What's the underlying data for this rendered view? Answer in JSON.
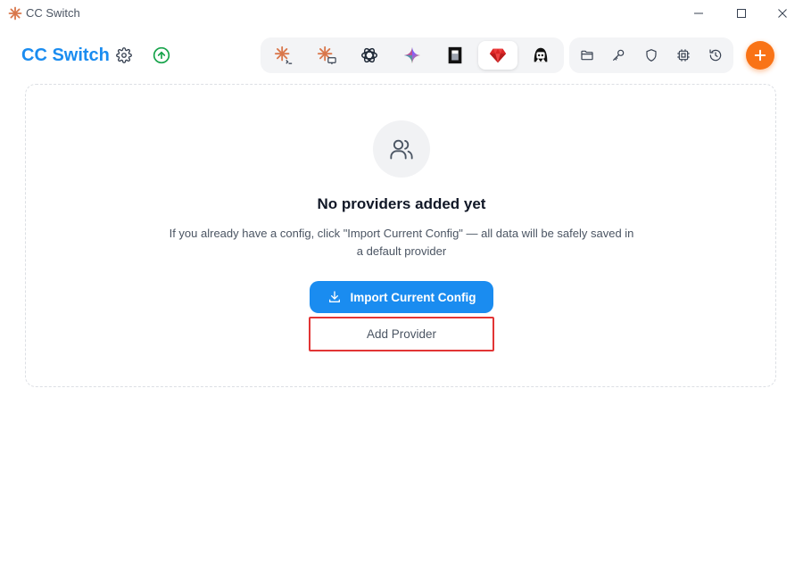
{
  "window": {
    "title": "CC Switch",
    "controls": {
      "minimize_icon": "minimize-icon",
      "maximize_icon": "maximize-icon",
      "close_icon": "close-icon"
    }
  },
  "header": {
    "brand": "CC Switch",
    "settings_icon": "gear-icon",
    "update_icon": "arrow-up-circle-icon",
    "accent_color": "#1a8cf0",
    "update_color": "#16a34a"
  },
  "app_switcher": {
    "tabs": [
      {
        "id": "claude-code",
        "icon": "claude-terminal-icon",
        "active": false
      },
      {
        "id": "claude-desktop",
        "icon": "claude-desktop-icon",
        "active": false
      },
      {
        "id": "openai",
        "icon": "openai-icon",
        "active": false
      },
      {
        "id": "gemini",
        "icon": "gemini-icon",
        "active": false
      },
      {
        "id": "opencode",
        "icon": "opencode-icon",
        "active": false
      },
      {
        "id": "ruby",
        "icon": "ruby-gem-icon",
        "active": true
      },
      {
        "id": "agent",
        "icon": "agent-avatar-icon",
        "active": false
      }
    ]
  },
  "toolbar": {
    "items": [
      {
        "id": "folder",
        "icon": "folder-icon"
      },
      {
        "id": "key",
        "icon": "key-icon"
      },
      {
        "id": "shield",
        "icon": "shield-icon"
      },
      {
        "id": "chip",
        "icon": "chip-icon"
      },
      {
        "id": "history",
        "icon": "history-icon"
      }
    ],
    "add_icon": "plus-icon",
    "add_color": "#f97316"
  },
  "empty_state": {
    "icon": "users-icon",
    "title": "No providers added yet",
    "description": "If you already have a config, click \"Import Current Config\" — all data will be safely saved in a default provider",
    "import_button": {
      "label": "Import Current Config",
      "icon": "download-icon"
    },
    "add_button": {
      "label": "Add Provider"
    },
    "highlight_color": "#e23535"
  }
}
